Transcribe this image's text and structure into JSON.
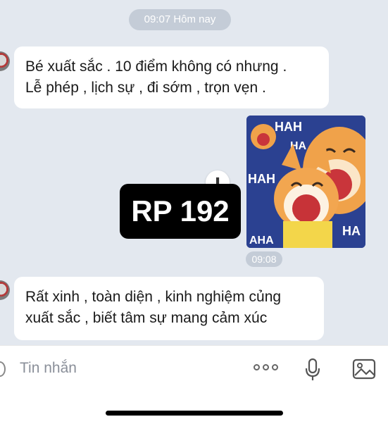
{
  "chat": {
    "date_label": "09:07 Hôm nay",
    "messages": [
      {
        "lines": [
          "Bé xuất sắc . 10 điểm không có nhưng .",
          "Lễ phép , lịch sự , đi sớm , trọn vẹn ."
        ]
      },
      {
        "lines": [
          "Rất xinh , toàn diện , kinh nghiệm củng",
          "xuất sắc , biết tâm sự mang cảm xúc"
        ]
      }
    ],
    "sticker": {
      "time": "09:08",
      "texts": [
        "HAH",
        "HA",
        "HAH",
        "HA",
        "AHA"
      ]
    },
    "watermark": "RP 192"
  },
  "input": {
    "placeholder": "Tin nhắn"
  },
  "colors": {
    "chat_bg": "#e3e8ef",
    "bubble": "#ffffff",
    "pill": "#c4ccd7"
  }
}
